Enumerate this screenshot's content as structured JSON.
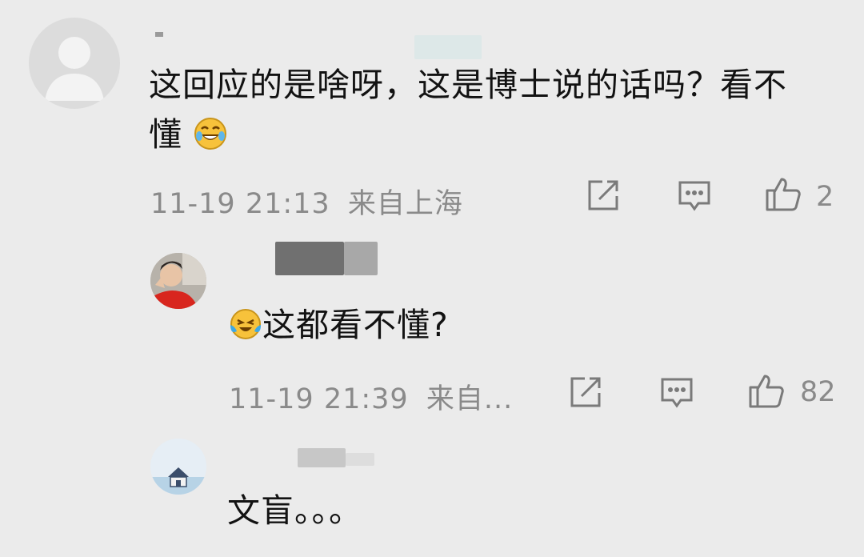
{
  "comments": [
    {
      "text_line1": "这回应的是啥呀，这是博士说的话吗？看不",
      "text_line2": "懂",
      "emoji": "laughing-tears",
      "timestamp": "11-19 21:13",
      "location": "来自上海",
      "likes": "2"
    },
    {
      "emoji": "crying-laughing",
      "text": "这都看不懂?",
      "timestamp": "11-19 21:39",
      "location": "来自...",
      "likes": "82"
    },
    {
      "text": "文盲。。。"
    }
  ],
  "icons": {
    "share": "share-icon",
    "comment": "comment-icon",
    "like": "thumbs-up-icon"
  },
  "colors": {
    "background": "#ebebeb",
    "text": "#121212",
    "meta": "#8a8a8a"
  }
}
